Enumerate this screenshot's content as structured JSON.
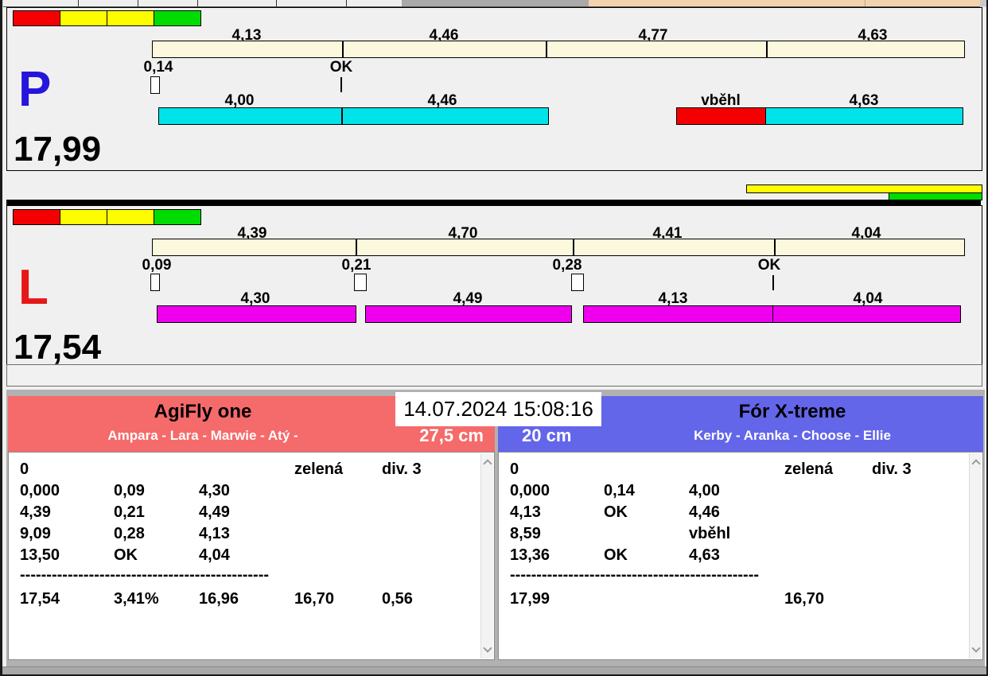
{
  "colors": {
    "cream": "#fbf8dd",
    "cyan": "#00e3e8",
    "magenta": "#ee00ee",
    "red": "#f40000",
    "yellow": "#fdfd00",
    "green": "#00dc00",
    "lane_p_letter": "#2615dc",
    "lane_l_letter": "#e51717",
    "team_left_header": "#f56a6a",
    "team_right_header": "#6366e9",
    "tan_strip": "#f2d3ae"
  },
  "lanes": [
    {
      "letter": "P",
      "total": "17,99",
      "splits": [
        "4,13",
        "4,46",
        "4,77",
        "4,63"
      ],
      "checks": [
        "0,14",
        "OK"
      ],
      "run_segments": [
        "4,00",
        "4,46",
        "vběhl",
        "4,63"
      ]
    },
    {
      "letter": "L",
      "total": "17,54",
      "splits": [
        "4,39",
        "4,70",
        "4,41",
        "4,04"
      ],
      "checks": [
        "0,09",
        "0,21",
        "0,28",
        "OK"
      ],
      "run_segments": [
        "4,30",
        "4,49",
        "4,13",
        "4,04"
      ]
    }
  ],
  "datetime": "14.07.2024 15:08:16",
  "teams": {
    "left": {
      "name": "AgiFly one",
      "members": "Ampara - Lara - Marwie - Atý -",
      "jump_height": "27,5 cm",
      "rows": [
        [
          "0",
          "",
          "",
          "zelená",
          "div. 3"
        ],
        [
          "0,000",
          "0,09",
          "4,30",
          "",
          ""
        ],
        [
          "4,39",
          "0,21",
          "4,49",
          "",
          ""
        ],
        [
          "9,09",
          "0,28",
          "4,13",
          "",
          ""
        ],
        [
          "13,50",
          "OK",
          "4,04",
          "",
          ""
        ]
      ],
      "divider": "-----------------------------------------------",
      "summary": [
        "17,54",
        "3,41%",
        "16,96",
        "16,70",
        "0,56"
      ]
    },
    "right": {
      "name": "Fór X-treme",
      "members": "Kerby - Aranka - Choose - Ellie",
      "jump_height": "20 cm",
      "rows": [
        [
          "0",
          "",
          "",
          "zelená",
          "div. 3"
        ],
        [
          "0,000",
          "0,14",
          "4,00",
          "",
          ""
        ],
        [
          "4,13",
          "OK",
          "4,46",
          "",
          ""
        ],
        [
          "8,59",
          "",
          "vběhl",
          "",
          ""
        ],
        [
          "13,36",
          "OK",
          "4,63",
          "",
          ""
        ]
      ],
      "divider": "-----------------------------------------------",
      "summary": [
        "17,99",
        "",
        "",
        "16,70",
        ""
      ]
    }
  }
}
